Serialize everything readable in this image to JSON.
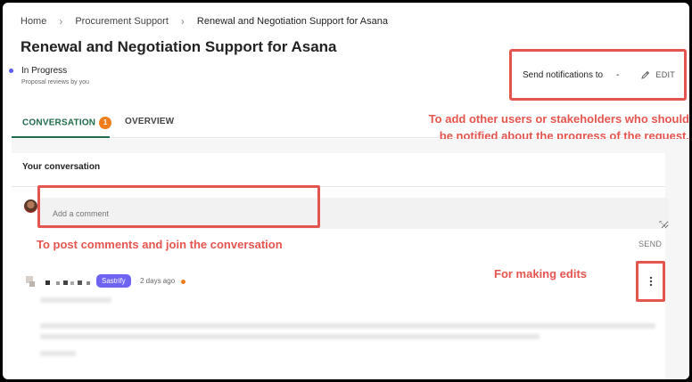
{
  "breadcrumb": {
    "items": [
      "Home",
      "Procurement Support",
      "Renewal and Negotiation Support for Asana"
    ]
  },
  "page": {
    "title": "Renewal and Negotiation Support for Asana",
    "status": "In Progress",
    "status_sub": "Proposal reviews by you"
  },
  "notifications": {
    "label": "Send notifications to",
    "value": "-",
    "edit_label": "EDIT"
  },
  "tabs": {
    "conversation_label": "CONVERSATION",
    "conversation_count": "1",
    "overview_label": "OVERVIEW"
  },
  "conversation": {
    "title": "Your conversation",
    "comment_placeholder": "Add a comment",
    "send_label": "SEND",
    "comment": {
      "tag": "Sastrify",
      "time": "2 days ago"
    }
  },
  "annotations": {
    "stakeholders_line1": "To add other users or stakeholders who should",
    "stakeholders_line2": "be notified about the progress of the request.",
    "post_comments": "To post comments and join the conversation",
    "making_edits": "For making edits"
  },
  "colors": {
    "accent_green": "#1f6b4b",
    "badge_orange": "#f07d1b",
    "chip_purple": "#6f63f2",
    "annotation_red": "#e5554f"
  }
}
